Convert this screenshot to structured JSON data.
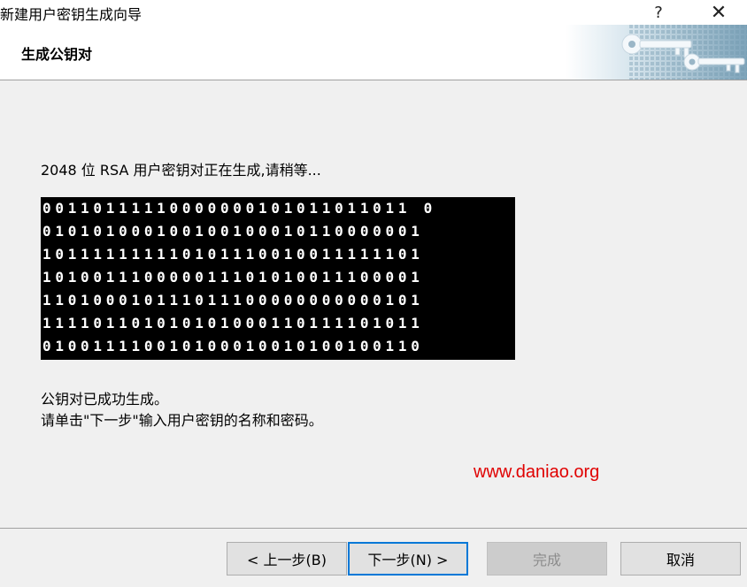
{
  "window": {
    "title": "新建用户密钥生成向导",
    "help_glyph": "?",
    "close_glyph": "✕"
  },
  "header": {
    "title": "生成公钥对",
    "art_icon": "keys-icon"
  },
  "main": {
    "progress_text": "2048 位 RSA 用户密钥对正在生成,请稍等...",
    "bits_rows": [
      "00110111110000000101011011011 0",
      "010101000100100100010110000001",
      "101111111110101110010011111101",
      "101001110000011101010011100001",
      "110100010111011100000000000101",
      "111101101010101000110111101011",
      "010011110010100010010100100110"
    ],
    "done_text": "公钥对已成功生成。",
    "hint_text": "请单击\"下一步\"输入用户密钥的名称和密码。",
    "watermark": "www.daniao.org",
    "watermark_color": "#e00000"
  },
  "footer": {
    "back_label": "< 上一步(B)",
    "next_label": "下一步(N) >",
    "finish_label": "完成",
    "cancel_label": "取消"
  }
}
